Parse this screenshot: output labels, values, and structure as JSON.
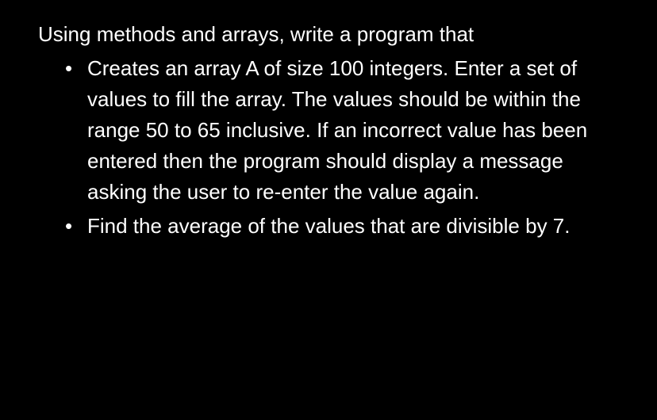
{
  "intro": "Using methods and arrays, write a program that",
  "bullets": [
    "Creates an array A of size 100 integers.  Enter a set of values to fill the array.  The values should be within the range 50 to 65 inclusive. If an incorrect value has been entered then the program should display a message asking the user to re-enter the value again.",
    "Find the average of the values that are divisible by 7."
  ]
}
